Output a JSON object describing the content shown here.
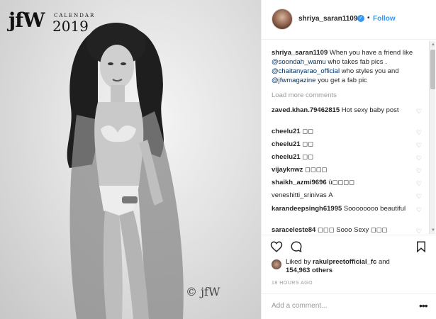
{
  "photo": {
    "brand": {
      "jfw": "jfW",
      "calendar": "CALENDAR",
      "year": "2019"
    },
    "watermark": "© jfW"
  },
  "post": {
    "username": "shriya_saran1109",
    "verified_icon": "verified-badge-icon",
    "separator": "•",
    "follow_label": "Follow",
    "caption": {
      "username": "shriya_saran1109",
      "text_1": " When you have a friend like ",
      "mention_1": "@soondah_wamu",
      "text_2": " who takes fab pics . ",
      "mention_2": "@chaitanyarao_official",
      "text_3": " who styles you and ",
      "mention_3": "@jfwmagazine",
      "text_4": " you get a fab pic"
    },
    "load_more": "Load more comments",
    "comments": [
      {
        "user": "zaved.khan.79462815",
        "text": "Hot sexy baby post"
      },
      {
        "user": "cheelu21",
        "text": "◻◻"
      },
      {
        "user": "cheelu21",
        "text": "◻◻"
      },
      {
        "user": "cheelu21",
        "text": "◻◻"
      },
      {
        "user": "vijayknwz",
        "text": "◻◻◻◻"
      },
      {
        "user": "shaikh_azmi9696",
        "text": "ü◻◻◻◻"
      },
      {
        "user": "veneshitti_srinivas",
        "text": "A"
      },
      {
        "user": "karandeepsingh61995",
        "text": "Soooooooo beautiful"
      },
      {
        "user": "saraceleste84",
        "text": "◻◻◻ Sooo Sexy ◻◻◻"
      }
    ],
    "liked_by": {
      "prefix": "Liked by ",
      "user": "rakulpreetofficial_fc",
      "and": " and",
      "count": "154,963 others"
    },
    "time": "18 HOURS AGO",
    "add_comment_placeholder": "Add a comment...",
    "more_label": "•••"
  },
  "colors": {
    "accent": "#3897f0",
    "mention": "#003569",
    "muted": "#999999"
  }
}
